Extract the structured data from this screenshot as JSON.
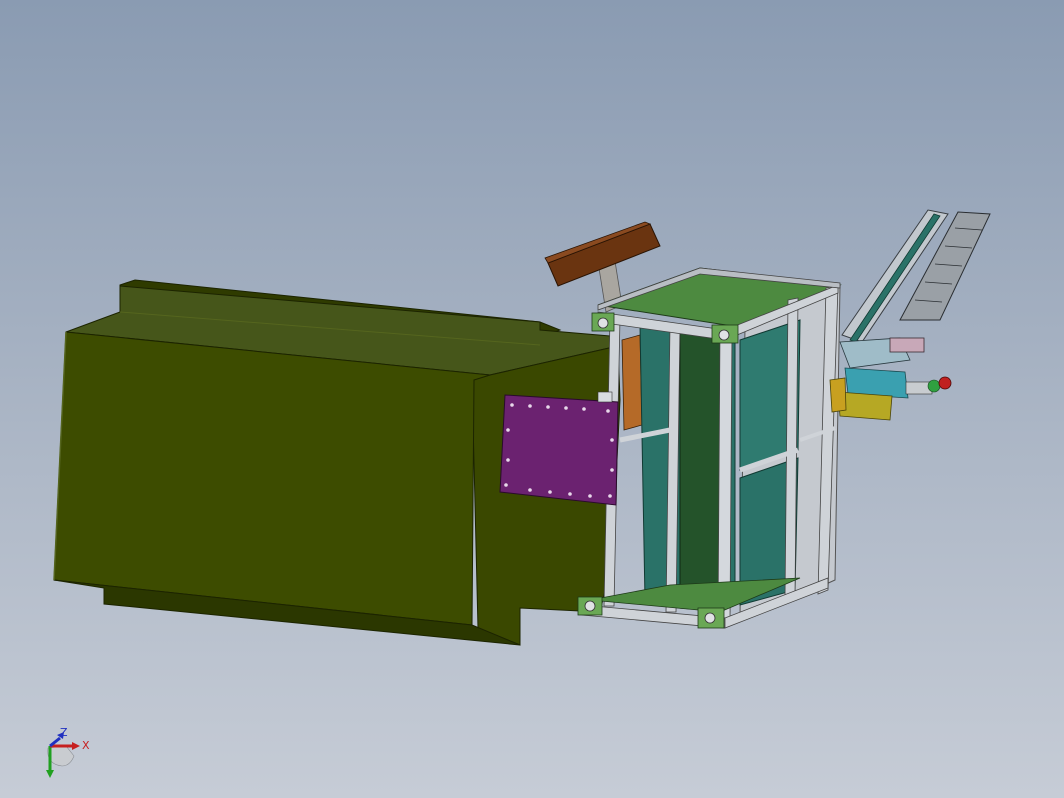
{
  "viewport": {
    "background_top": "#8a9bb2",
    "background_bottom": "#c6ccd6"
  },
  "model": {
    "parts": [
      {
        "name": "green-enclosure",
        "color": "#3b4a00"
      },
      {
        "name": "purple-mounting-plate",
        "color": "#6b2270"
      },
      {
        "name": "brown-handle-arm",
        "color": "#6a3410"
      },
      {
        "name": "aluminum-frame-cabinet",
        "color": "#c8ccd2"
      },
      {
        "name": "teal-side-panel",
        "color": "#2a7268"
      },
      {
        "name": "linear-actuator-arm",
        "color": "#a8b0b8"
      },
      {
        "name": "yellow-motor-block",
        "color": "#b6a824"
      },
      {
        "name": "red-indicator-lamp",
        "color": "#c02020"
      }
    ]
  },
  "triad": {
    "x_label": "X",
    "y_label": "Y",
    "z_label": "Z",
    "x_color": "#c62020",
    "y_color": "#20a020",
    "z_color": "#2030c0"
  }
}
